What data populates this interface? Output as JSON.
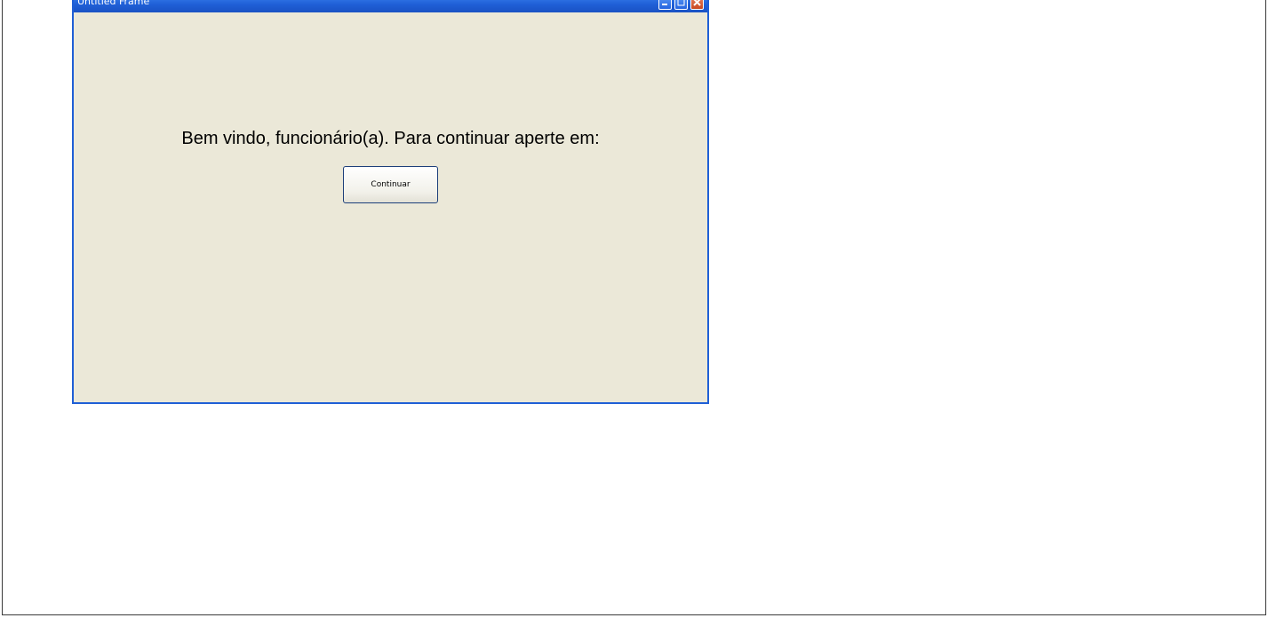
{
  "window": {
    "title": "Untitled Frame",
    "controls": {
      "minimize_icon": "minimize-icon",
      "maximize_icon": "maximize-icon",
      "close_icon": "close-icon"
    }
  },
  "content": {
    "welcome_text": "Bem vindo, funcionário(a). Para continuar aperte em:",
    "continue_button_label": "Continuar"
  },
  "colors": {
    "window_border": "#1f5fd6",
    "window_background": "#ebe8d8",
    "close_button": "#c9471f"
  }
}
